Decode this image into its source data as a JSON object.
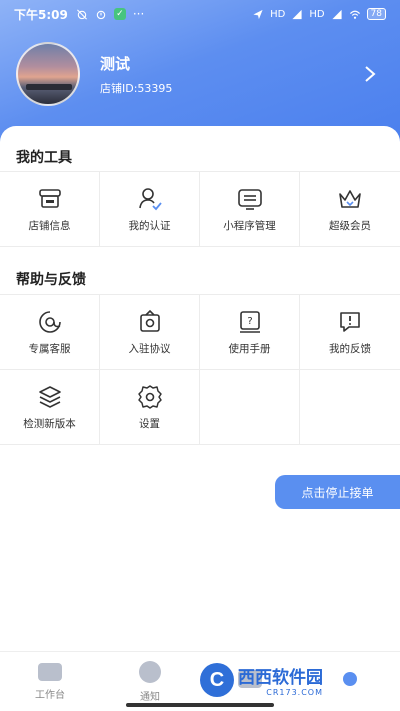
{
  "status_bar": {
    "time": "下午5:09",
    "battery": "78",
    "signal_label_1": "HD",
    "signal_label_2": "HD",
    "dots": "···"
  },
  "profile": {
    "shop_name": "测试",
    "shop_id": "店铺ID:53395"
  },
  "tools": {
    "title": "我的工具",
    "items": [
      {
        "label": "店铺信息",
        "icon": "store-icon"
      },
      {
        "label": "我的认证",
        "icon": "user-verify-icon"
      },
      {
        "label": "小程序管理",
        "icon": "mini-program-icon"
      },
      {
        "label": "超级会员",
        "icon": "crown-icon"
      }
    ]
  },
  "help": {
    "title": "帮助与反馈",
    "items": [
      {
        "label": "专属客服",
        "icon": "customer-service-icon"
      },
      {
        "label": "入驻协议",
        "icon": "agreement-icon"
      },
      {
        "label": "使用手册",
        "icon": "manual-icon"
      },
      {
        "label": "我的反馈",
        "icon": "feedback-icon"
      },
      {
        "label": "检测新版本",
        "icon": "layers-icon"
      },
      {
        "label": "设置",
        "icon": "gear-icon"
      }
    ]
  },
  "stop_button": "点击停止接单",
  "tabbar": [
    {
      "label": "工作台"
    },
    {
      "label": "通知"
    }
  ],
  "watermark": {
    "logo": "C",
    "main": "西西软件园",
    "sub": "CR173.COM"
  },
  "colors": {
    "accent": "#5a8ff0",
    "hero_start": "#8fb3f7",
    "hero_end": "#4a7fee"
  }
}
